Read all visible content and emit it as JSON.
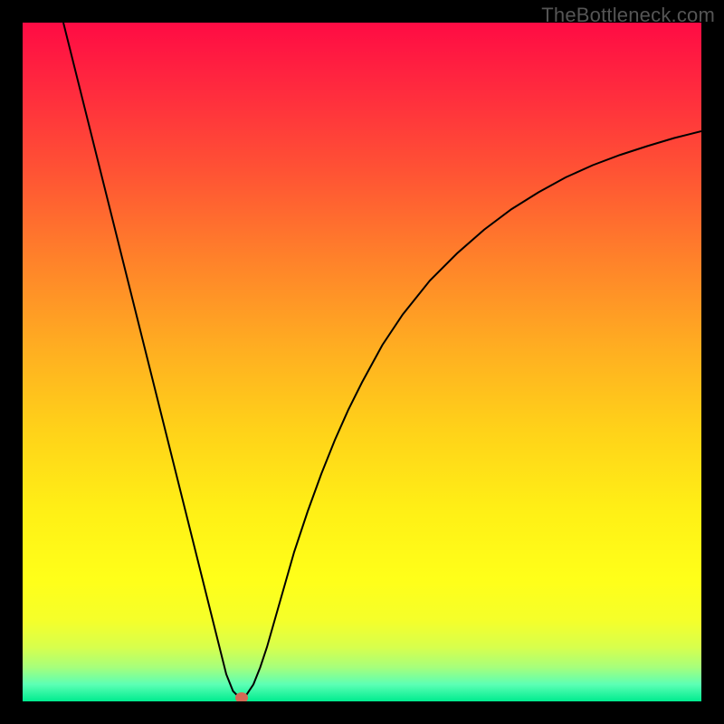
{
  "watermark": "TheBottleneck.com",
  "chart_data": {
    "type": "line",
    "title": "",
    "xlabel": "",
    "ylabel": "",
    "xlim": [
      0,
      100
    ],
    "ylim": [
      0,
      100
    ],
    "background_gradient": {
      "stops": [
        {
          "pos": 0.0,
          "color": "#ff0b44"
        },
        {
          "pos": 0.1,
          "color": "#ff2b3e"
        },
        {
          "pos": 0.22,
          "color": "#ff5334"
        },
        {
          "pos": 0.35,
          "color": "#ff822a"
        },
        {
          "pos": 0.48,
          "color": "#ffae21"
        },
        {
          "pos": 0.6,
          "color": "#ffd219"
        },
        {
          "pos": 0.72,
          "color": "#fff016"
        },
        {
          "pos": 0.82,
          "color": "#ffff19"
        },
        {
          "pos": 0.88,
          "color": "#f5ff2a"
        },
        {
          "pos": 0.92,
          "color": "#d8ff4c"
        },
        {
          "pos": 0.95,
          "color": "#a6ff7c"
        },
        {
          "pos": 0.975,
          "color": "#5cffb5"
        },
        {
          "pos": 1.0,
          "color": "#00ec8f"
        }
      ]
    },
    "series": [
      {
        "name": "bottleneck-curve",
        "stroke": "#000000",
        "stroke_width": 2,
        "x": [
          6,
          8,
          10,
          12,
          14,
          16,
          18,
          20,
          22,
          24,
          26,
          27,
          28,
          29,
          30,
          31,
          32,
          33,
          34,
          35,
          36,
          37,
          38,
          39,
          40,
          42,
          44,
          46,
          48,
          50,
          53,
          56,
          60,
          64,
          68,
          72,
          76,
          80,
          84,
          88,
          92,
          96,
          100
        ],
        "y": [
          100,
          92,
          84,
          76,
          68,
          60,
          52,
          44,
          36,
          28,
          20,
          16,
          12,
          8,
          4,
          1.5,
          0.5,
          1,
          2.5,
          5,
          8,
          11.5,
          15,
          18.5,
          22,
          28,
          33.5,
          38.5,
          43,
          47,
          52.5,
          57,
          62,
          66,
          69.5,
          72.5,
          75,
          77.2,
          79,
          80.5,
          81.8,
          83,
          84
        ]
      }
    ],
    "marker": {
      "x": 32.2,
      "y": 0.6,
      "color": "#d46a55"
    }
  }
}
